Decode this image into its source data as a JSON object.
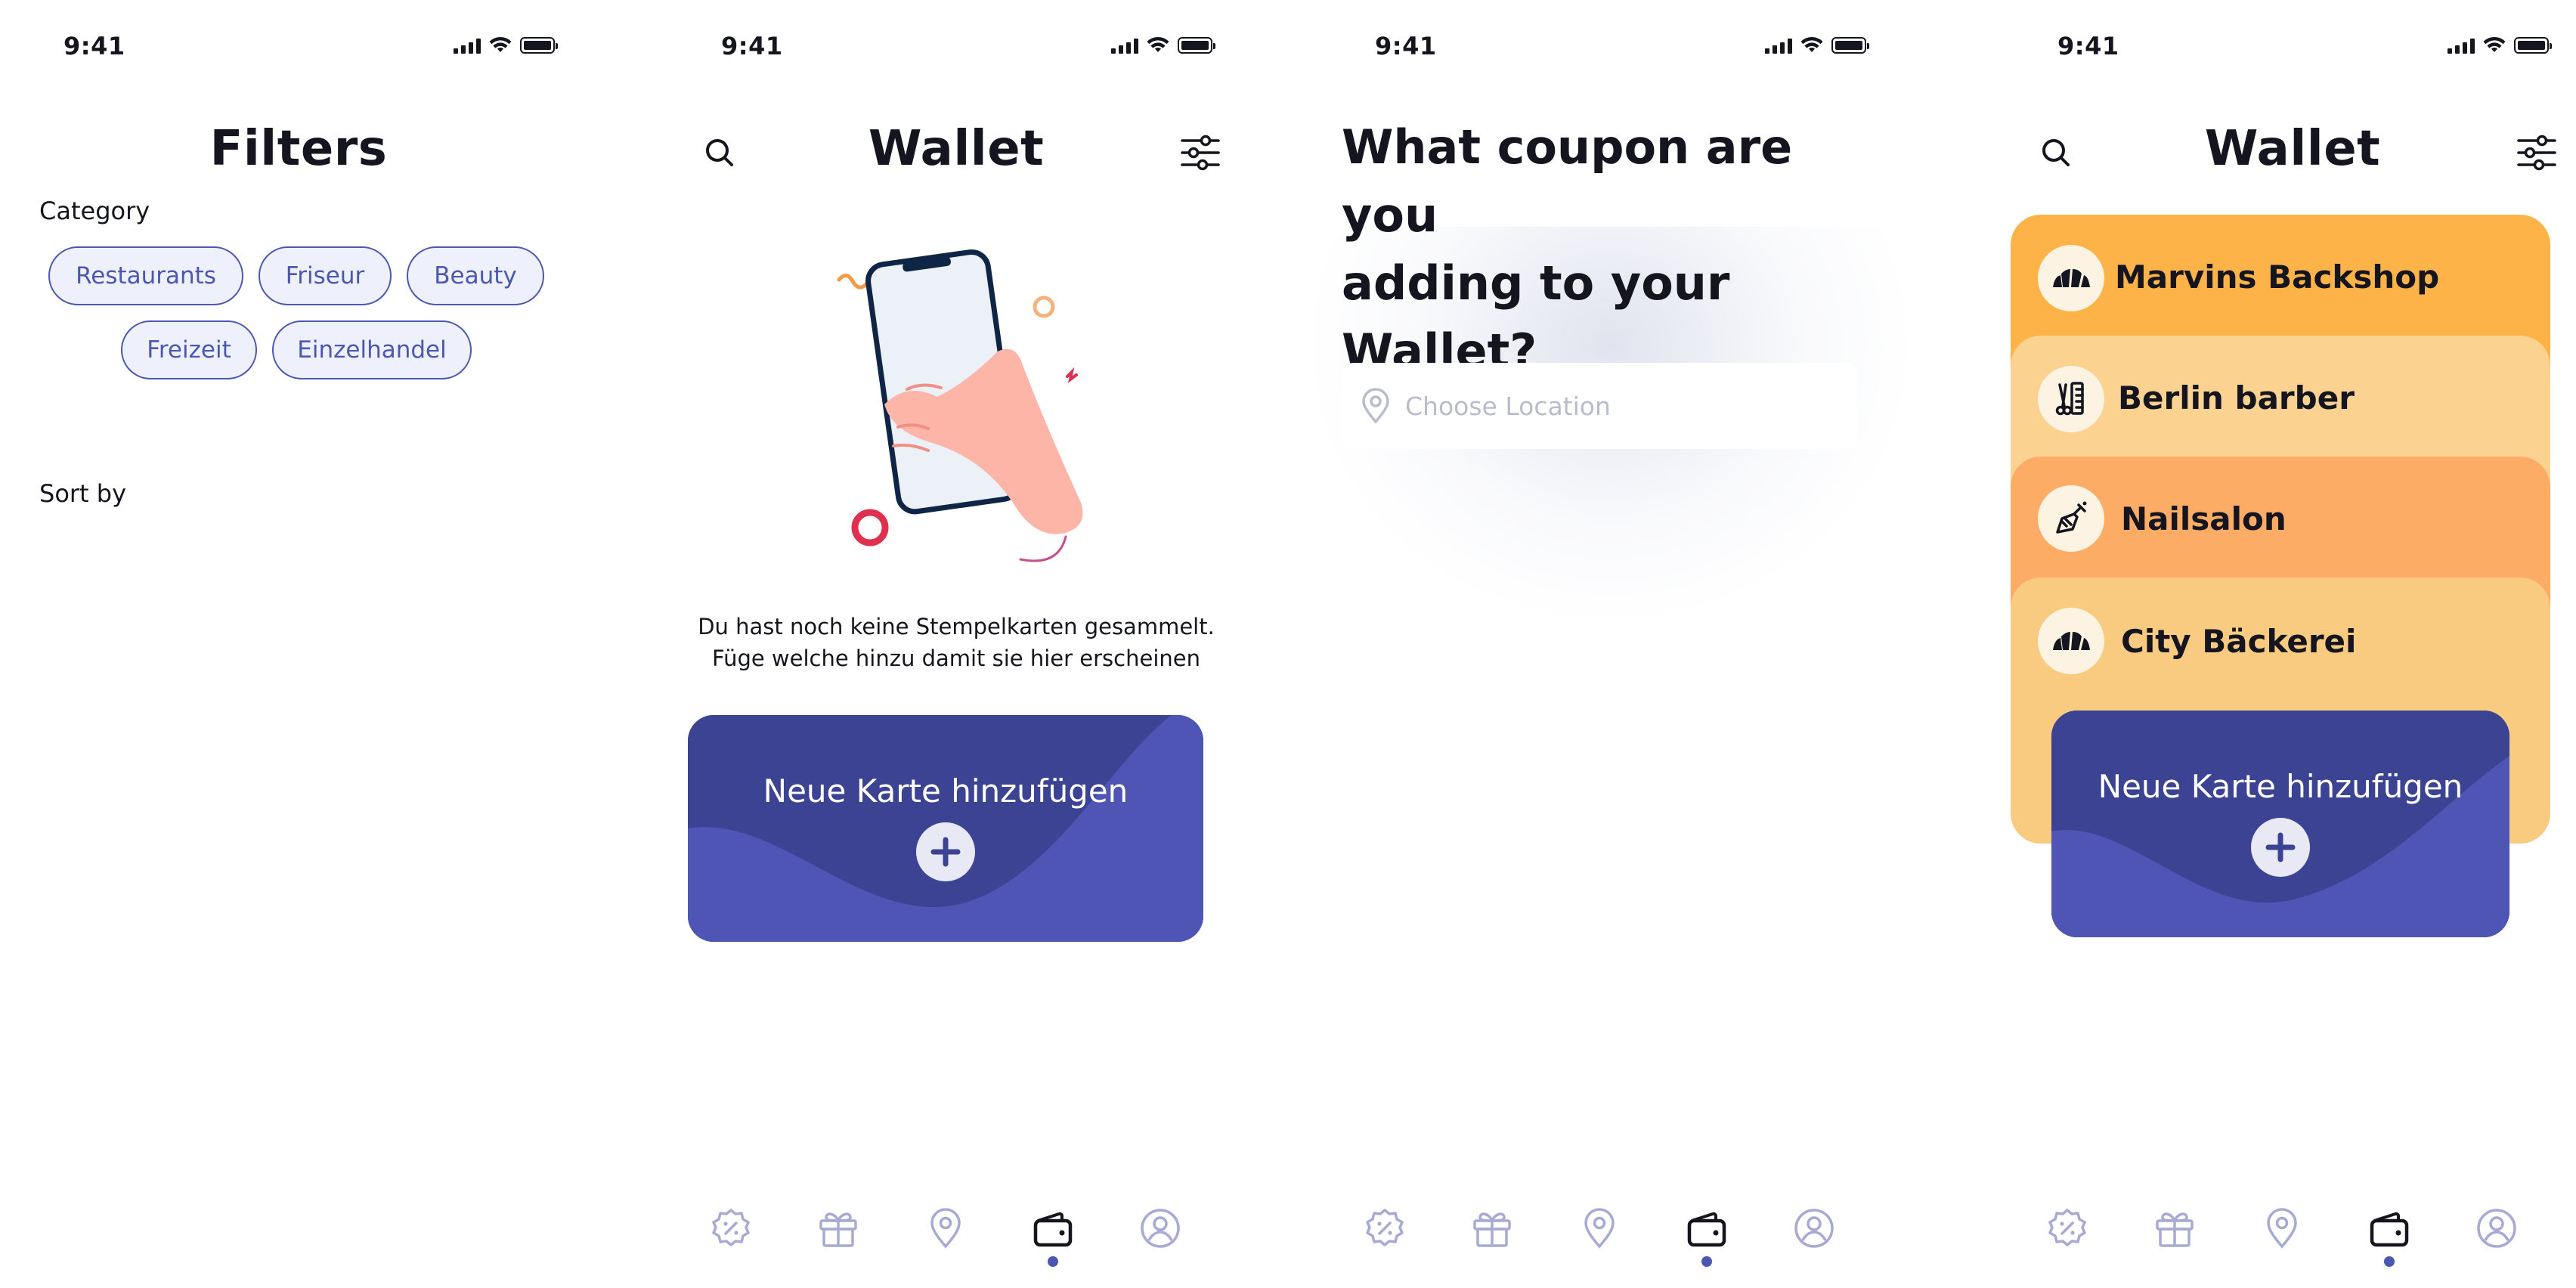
{
  "status_bar": {
    "time": "9:41"
  },
  "filters": {
    "title": "Filters",
    "category_label": "Category",
    "chips": [
      "Restaurants",
      "Friseur",
      "Beauty",
      "Freizeit",
      "Einzelhandel"
    ],
    "sort_label": "Sort by"
  },
  "wallet_empty": {
    "title": "Wallet",
    "message_line1": "Du hast noch keine Stempelkarten gesammelt.",
    "message_line2": "Füge welche hinzu damit sie hier erscheinen",
    "add_card_label": "Neue Karte hinzufügen"
  },
  "coupon": {
    "question_line1": "What coupon are you",
    "question_line2": "adding to your",
    "question_line3": "Wallet?",
    "location_placeholder": "Choose Location"
  },
  "wallet_cards": {
    "title": "Wallet",
    "cards": [
      {
        "name": "Marvins Backshop",
        "icon": "croissant-icon",
        "color": "#fdb347"
      },
      {
        "name": "Berlin barber",
        "icon": "barber-tools-icon",
        "color": "#fcd291"
      },
      {
        "name": "Nailsalon",
        "icon": "nail-polish-icon",
        "color": "#fdac66"
      },
      {
        "name": "City Bäckerei",
        "icon": "croissant-icon",
        "color": "#f8cb80"
      }
    ],
    "add_card_label": "Neue Karte hinzufügen"
  },
  "tabbar": {
    "tabs": [
      {
        "icon": "discount-icon",
        "active": false
      },
      {
        "icon": "gift-icon",
        "active": false
      },
      {
        "icon": "location-pin-icon",
        "active": false
      },
      {
        "icon": "wallet-icon",
        "active": true
      },
      {
        "icon": "profile-icon",
        "active": false
      }
    ]
  },
  "colors": {
    "accent": "#4b57b0",
    "card_dark": "#3c4393",
    "card_light": "#5058b8",
    "icon_inactive": "#a7abd4"
  }
}
